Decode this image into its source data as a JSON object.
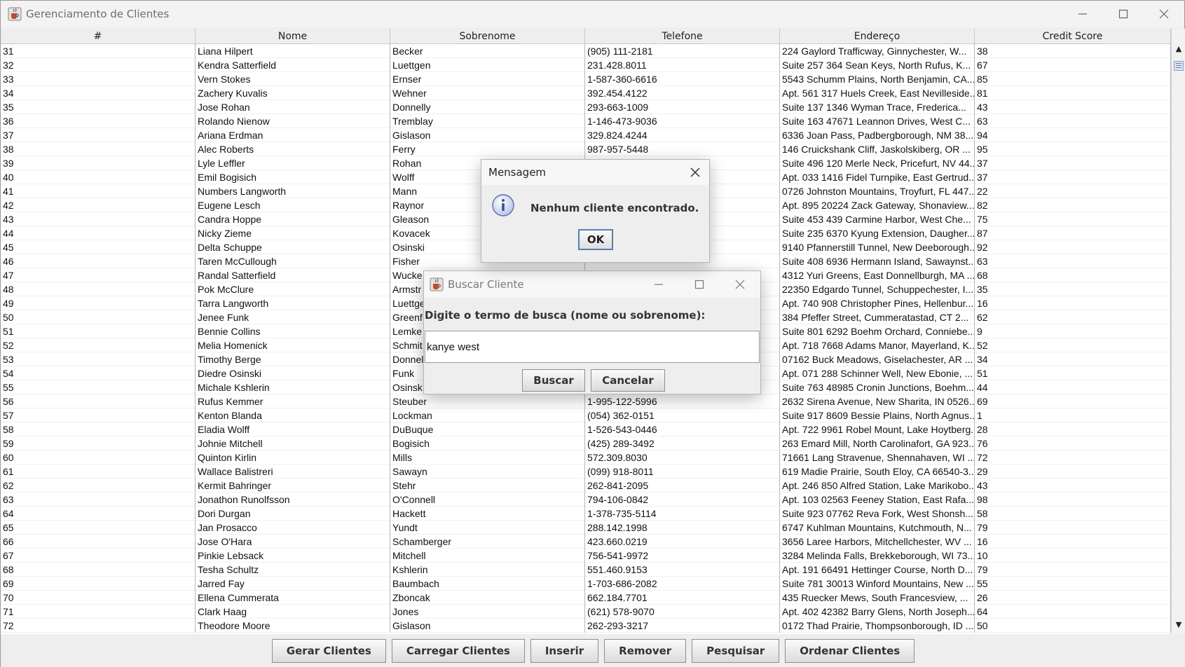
{
  "window": {
    "title": "Gerenciamento de Clientes"
  },
  "table": {
    "columns": [
      "#",
      "Nome",
      "Sobrenome",
      "Telefone",
      "Endereço",
      "Credit Score"
    ],
    "rows": [
      [
        "31",
        "Liana Hilpert",
        "Becker",
        "(905) 111-2181",
        "224 Gaylord Trafficway, Ginnychester, W...",
        "38"
      ],
      [
        "32",
        "Kendra Satterfield",
        "Luettgen",
        "231.428.8011",
        "Suite 257 364 Sean Keys, North Rufus, K...",
        "67"
      ],
      [
        "33",
        "Vern Stokes",
        "Ernser",
        "1-587-360-6616",
        "5543 Schumm Plains, North Benjamin, CA...",
        "85"
      ],
      [
        "34",
        "Zachery Kuvalis",
        "Wehner",
        "392.454.4122",
        "Apt. 561 317 Huels Creek, East Nevilleside...",
        "81"
      ],
      [
        "35",
        "Jose Rohan",
        "Donnelly",
        "293-663-1009",
        "Suite 137 1346 Wyman Trace, Frederica...",
        "43"
      ],
      [
        "36",
        "Rolando Nienow",
        "Tremblay",
        "1-146-473-9036",
        "Suite 163 47671 Leannon Drives, West C...",
        "63"
      ],
      [
        "37",
        "Ariana Erdman",
        "Gislason",
        "329.824.4244",
        "6336 Joan Pass, Padbergborough, NM 38...",
        "94"
      ],
      [
        "38",
        "Alec Roberts",
        "Ferry",
        "987-957-5448",
        "146 Cruickshank Cliff, Jaskolskiberg, OR ...",
        "95"
      ],
      [
        "39",
        "Lyle Leffler",
        "Rohan",
        "",
        "Suite 496 120 Merle Neck, Pricefurt, NV 44...",
        "37"
      ],
      [
        "40",
        "Emil Bogisich",
        "Wolff",
        "",
        "Apt. 033 1416 Fidel Turnpike, East Gertrud...",
        "37"
      ],
      [
        "41",
        "Numbers Langworth",
        "Mann",
        "",
        "0726 Johnston Mountains, Troyfurt, FL 447...",
        "22"
      ],
      [
        "42",
        "Eugene Lesch",
        "Raynor",
        "",
        "Apt. 895 20224 Zack Gateway, Shonaview...",
        "82"
      ],
      [
        "43",
        "Candra Hoppe",
        "Gleason",
        "",
        "Suite 453 439 Carmine Harbor, West Che...",
        "75"
      ],
      [
        "44",
        "Nicky Zieme",
        "Kovacek",
        "",
        "Suite 235 6370 Kyung Extension, Daugher...",
        "87"
      ],
      [
        "45",
        "Delta Schuppe",
        "Osinski",
        "",
        "9140 Pfannerstill Tunnel, New Deeborough...",
        "92"
      ],
      [
        "46",
        "Taren McCullough",
        "Fisher",
        "",
        "Suite 408 6936 Hermann Island, Sawaynst...",
        "63"
      ],
      [
        "47",
        "Randal Satterfield",
        "Wucke",
        "",
        "4312 Yuri Greens, East Donnellburgh, MA ...",
        "68"
      ],
      [
        "48",
        "Pok McClure",
        "Armstr",
        "",
        "22350 Edgardo Tunnel, Schuppechester, I...",
        "35"
      ],
      [
        "49",
        "Tarra Langworth",
        "Luettge",
        "",
        "Apt. 740 908 Christopher Pines, Hellenbur...",
        "16"
      ],
      [
        "50",
        "Jenee Funk",
        "Greenf",
        "",
        "384 Pfeffer Street, Cummeratastad, CT 2...",
        "62"
      ],
      [
        "51",
        "Bennie Collins",
        "Lemke",
        "",
        "Suite 801 6292 Boehm Orchard, Conniebe...",
        "9"
      ],
      [
        "52",
        "Melia Homenick",
        "Schmit",
        "",
        "Apt. 718 7668 Adams Manor, Mayerland, K...",
        "52"
      ],
      [
        "53",
        "Timothy Berge",
        "Donnel",
        "",
        "07162 Buck Meadows, Giselachester, AR ...",
        "34"
      ],
      [
        "54",
        "Diedre Osinski",
        "Funk",
        "",
        "Apt. 071 288 Schinner Well, New Ebonie, ...",
        "51"
      ],
      [
        "55",
        "Michale Kshlerin",
        "Osinsk",
        "",
        "Suite 763 48985 Cronin Junctions, Boehm...",
        "44"
      ],
      [
        "56",
        "Rufus Kemmer",
        "Steuber",
        "1-995-122-5996",
        "2632 Sirena Avenue, New Sharita, IN 0526...",
        "69"
      ],
      [
        "57",
        "Kenton Blanda",
        "Lockman",
        "(054) 362-0151",
        "Suite 917 8609 Bessie Plains, North Agnus...",
        "1"
      ],
      [
        "58",
        "Eladia Wolff",
        "DuBuque",
        "1-526-543-0446",
        "Apt. 722 9961 Robel Mount, Lake Hoytberg...",
        "28"
      ],
      [
        "59",
        "Johnie Mitchell",
        "Bogisich",
        "(425) 289-3492",
        "263 Emard Mill, North Carolinafort, GA 923...",
        "76"
      ],
      [
        "60",
        "Quinton Kirlin",
        "Mills",
        "572.309.8030",
        "71661 Lang Stravenue, Shennahaven, WI ...",
        "72"
      ],
      [
        "61",
        "Wallace Balistreri",
        "Sawayn",
        "(099) 918-8011",
        "619 Madie Prairie, South Eloy, CA 66540-3...",
        "29"
      ],
      [
        "62",
        "Kermit Bahringer",
        "Stehr",
        "262-841-2095",
        "Apt. 246 850 Alfred Station, Lake Marikobo...",
        "43"
      ],
      [
        "63",
        "Jonathon Runolfsson",
        "O'Connell",
        "794-106-0842",
        "Apt. 103 02563 Feeney Station, East Rafa...",
        "98"
      ],
      [
        "64",
        "Dori Durgan",
        "Hackett",
        "1-378-735-5114",
        "Suite 923 07762 Reva Fork, West Shonsh...",
        "58"
      ],
      [
        "65",
        "Jan Prosacco",
        "Yundt",
        "288.142.1998",
        "6747 Kuhlman Mountains, Kutchmouth, N...",
        "79"
      ],
      [
        "66",
        "Jose O'Hara",
        "Schamberger",
        "423.660.0219",
        "3656 Laree Harbors, Mitchellchester, WV ...",
        "16"
      ],
      [
        "67",
        "Pinkie Lebsack",
        "Mitchell",
        "756-541-9972",
        "3284 Melinda Falls, Brekkeborough, WI 73...",
        "10"
      ],
      [
        "68",
        "Tesha Schultz",
        "Kshlerin",
        "551.460.9153",
        "Apt. 191 66491 Hettinger Course, North D...",
        "79"
      ],
      [
        "69",
        "Jarred Fay",
        "Baumbach",
        "1-703-686-2082",
        "Suite 781 30013 Winford Mountains, New ...",
        "55"
      ],
      [
        "70",
        "Ellena Cummerata",
        "Zboncak",
        "662.184.7701",
        "435 Ruecker Mews, South Francesview, ...",
        "26"
      ],
      [
        "71",
        "Clark Haag",
        "Jones",
        "(621) 578-9070",
        "Apt. 402 42382 Barry Glens, North Joseph...",
        "64"
      ],
      [
        "72",
        "Theodore Moore",
        "Gislason",
        "262-293-3217",
        "0172 Thad Prairie, Thompsonborough, ID ...",
        "50"
      ]
    ]
  },
  "buttons": {
    "gerar": "Gerar Clientes",
    "carregar": "Carregar Clientes",
    "inserir": "Inserir",
    "remover": "Remover",
    "pesquisar": "Pesquisar",
    "ordenar": "Ordenar Clientes"
  },
  "message_dialog": {
    "title": "Mensagem",
    "text": "Nenhum cliente encontrado.",
    "ok_label": "OK"
  },
  "search_dialog": {
    "title": "Buscar Cliente",
    "prompt": "Digite o termo de busca (nome ou sobrenome):",
    "input_value": "kanye west",
    "buscar_label": "Buscar",
    "cancelar_label": "Cancelar"
  },
  "icons": {
    "app": "java-cup-icon",
    "info": "info-icon",
    "close": "close-icon",
    "minimize": "minimize-icon",
    "maximize": "maximize-icon"
  },
  "colors": {
    "window_bg": "#eeeeee",
    "table_bg": "#ffffff",
    "button_border": "#8e8e8e",
    "focus_border": "#5a7fb0"
  }
}
